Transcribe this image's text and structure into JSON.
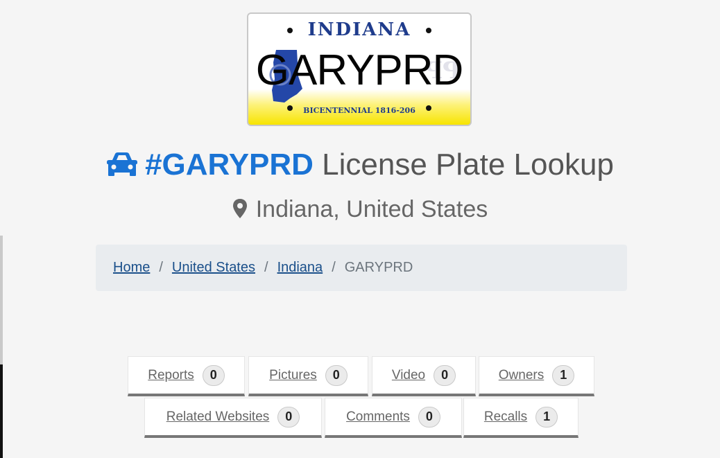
{
  "plate": {
    "state": "INDIANA",
    "number": "GARYPRD",
    "motto": "BICENTENNIAL 1816-206",
    "colors": {
      "state_text": "#1f3c8c",
      "band": "#f7e400"
    }
  },
  "header": {
    "icon": "car-icon",
    "plate_hash": "#GARYPRD",
    "title_suffix": " License Plate Lookup",
    "accent": "#1a73d4"
  },
  "location": {
    "icon": "map-marker-icon",
    "text": "Indiana, United States"
  },
  "breadcrumb": {
    "items": [
      {
        "label": "Home",
        "link": true
      },
      {
        "label": "United States",
        "link": true
      },
      {
        "label": "Indiana",
        "link": true
      },
      {
        "label": "GARYPRD",
        "link": false
      }
    ],
    "separator": "/"
  },
  "tabs": [
    {
      "label": "Reports",
      "count": "0"
    },
    {
      "label": "Pictures",
      "count": "0"
    },
    {
      "label": "Video",
      "count": "0"
    },
    {
      "label": "Owners",
      "count": "1"
    },
    {
      "label": "Related Websites",
      "count": "0"
    },
    {
      "label": "Comments",
      "count": "0"
    },
    {
      "label": "Recalls",
      "count": "1"
    }
  ]
}
